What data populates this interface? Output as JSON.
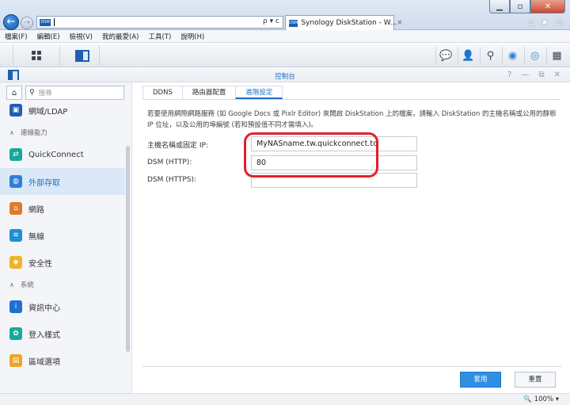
{
  "browser": {
    "address_value": "",
    "tab_favicon": "DSM",
    "tab_title": "Synology DiskStation - W...",
    "tab_close": "×",
    "search_glyph": "ρ",
    "dropdown_glyph": "▾",
    "refresh_glyph": "c",
    "menu": [
      "檔案(F)",
      "編輯(E)",
      "檢視(V)",
      "我的最愛(A)",
      "工具(T)",
      "說明(H)"
    ],
    "zoom": "100%"
  },
  "dsm": {
    "window_title": "控制台"
  },
  "sidebar": {
    "search_placeholder": "搜尋",
    "items": [
      {
        "type": "item",
        "label": "網域/LDAP",
        "icon": "directory-icon",
        "color": "#1f5fb2"
      },
      {
        "type": "section",
        "label": "連線能力"
      },
      {
        "type": "item",
        "label": "QuickConnect",
        "icon": "quickconnect-icon",
        "color": "#18a89a"
      },
      {
        "type": "item",
        "label": "外部存取",
        "icon": "globe-icon",
        "color": "#2f7fd6",
        "active": true
      },
      {
        "type": "item",
        "label": "網路",
        "icon": "home-network-icon",
        "color": "#e07b2a"
      },
      {
        "type": "item",
        "label": "無線",
        "icon": "wifi-icon",
        "color": "#1f8fd6"
      },
      {
        "type": "item",
        "label": "安全性",
        "icon": "shield-icon",
        "color": "#f0b323"
      },
      {
        "type": "section",
        "label": "系統"
      },
      {
        "type": "item",
        "label": "資訊中心",
        "icon": "info-icon",
        "color": "#1f6fd0"
      },
      {
        "type": "item",
        "label": "登入樣式",
        "icon": "palette-icon",
        "color": "#18a89a"
      },
      {
        "type": "item",
        "label": "區域選項",
        "icon": "region-icon",
        "color": "#f0a323"
      }
    ]
  },
  "content": {
    "tabs": [
      {
        "label": "DDNS"
      },
      {
        "label": "路由器配置"
      },
      {
        "label": "進階設定",
        "active": true
      }
    ],
    "description": "若要使用網際網路服務 (如 Google Docs 或 Pixlr Editor) 來開啟 DiskStation 上的檔案，請輸入 DiskStation 的主機名稱或公用的靜態 IP 位址，以及公用的埠編號 (若和預設值不同才需填入)。",
    "fields": [
      {
        "label": "主機名稱或固定 IP:",
        "value": "MyNASname.tw.quickconnect.to"
      },
      {
        "label": "DSM (HTTP):",
        "value": "80"
      },
      {
        "label": "DSM (HTTPS):",
        "value": ""
      }
    ],
    "apply_label": "套用",
    "reset_label": "重置"
  },
  "accent_color": "#1e6fc6",
  "highlight_color": "#e2202b"
}
